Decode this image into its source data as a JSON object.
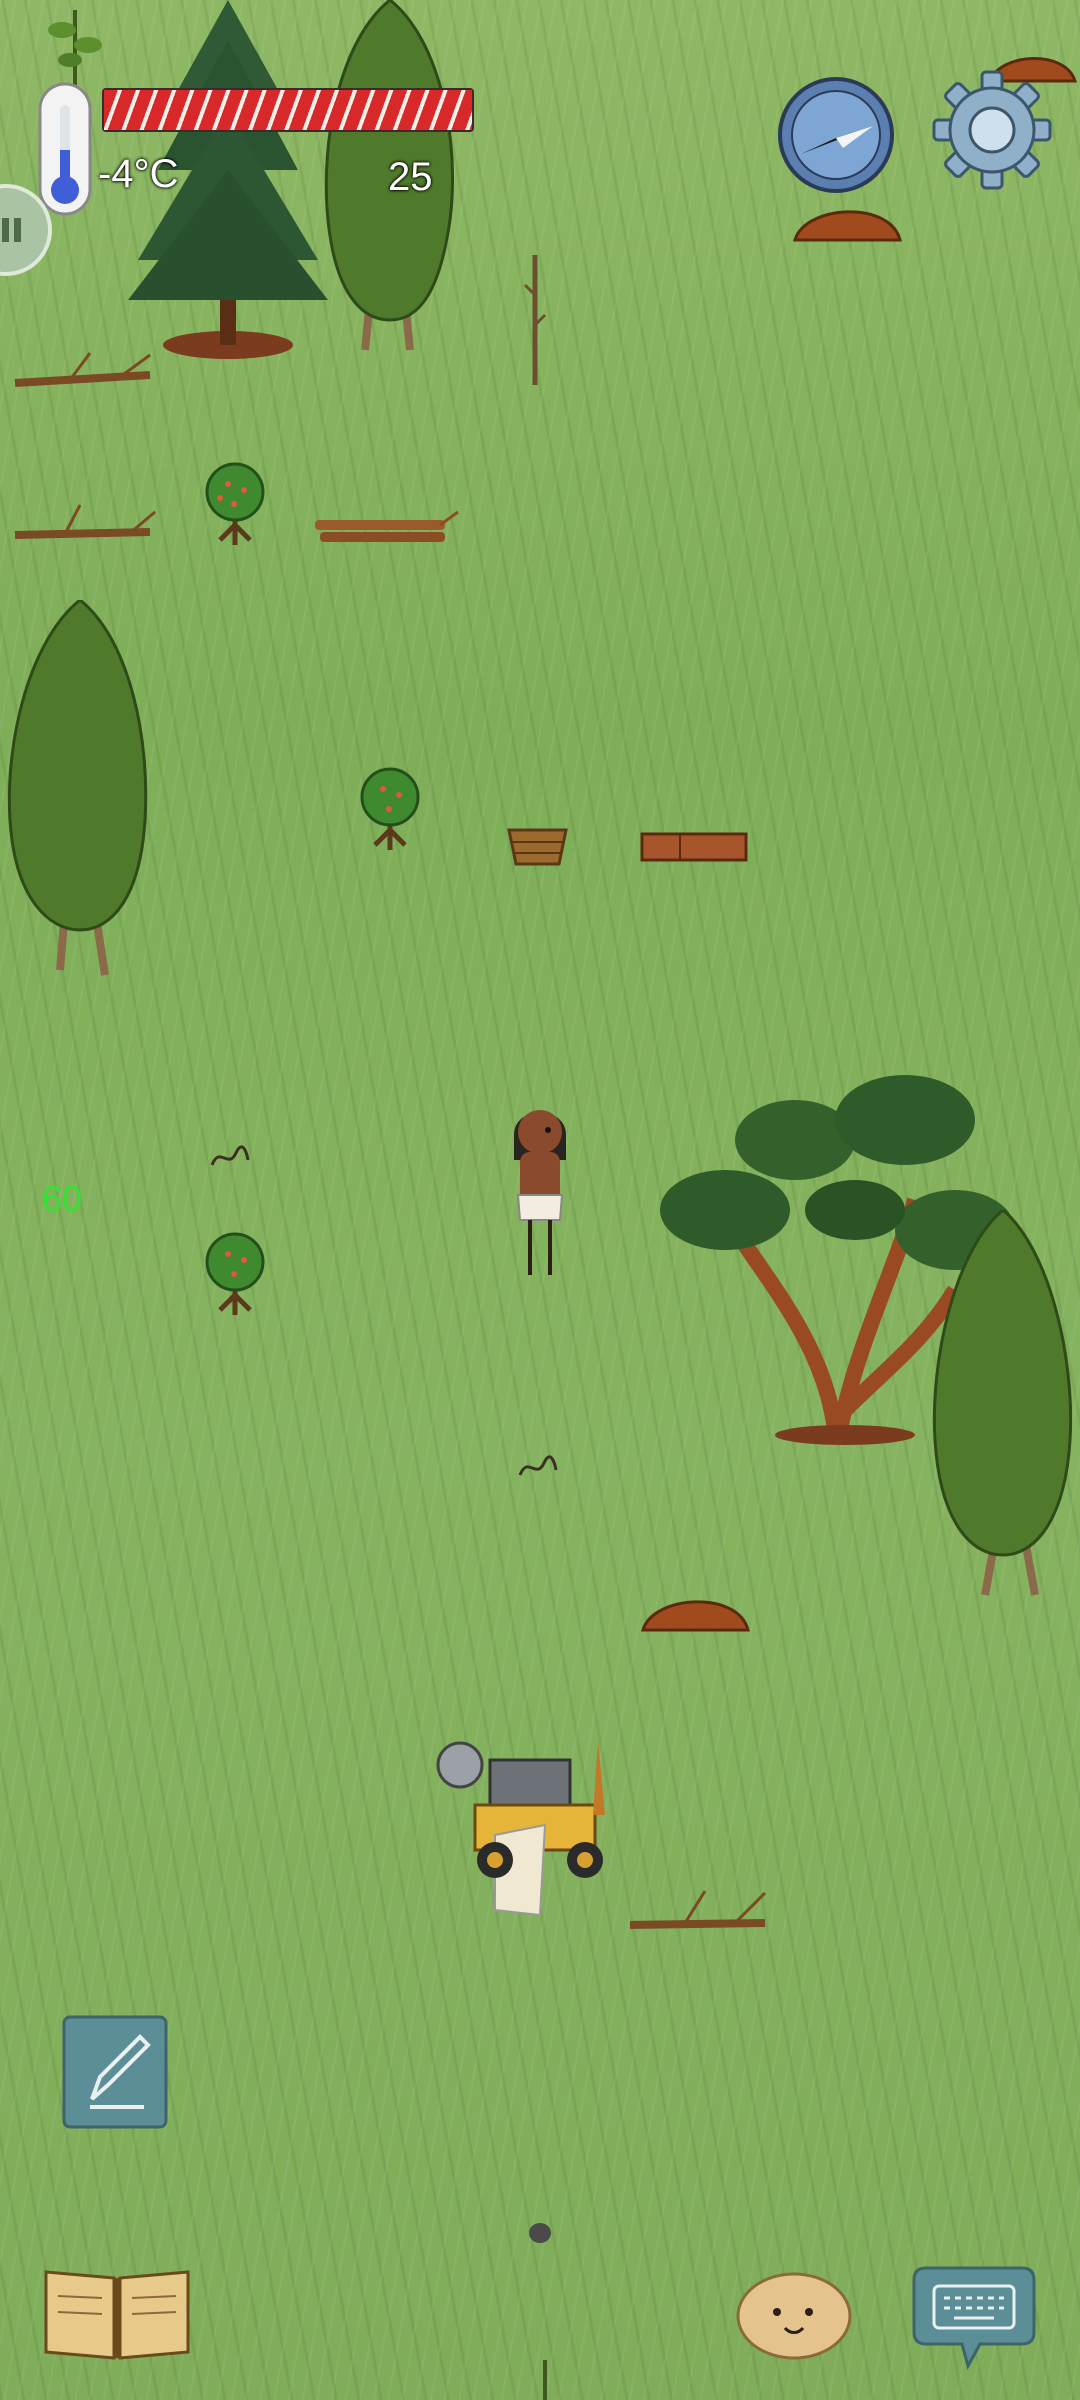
{
  "hud": {
    "temperature": "-4°C",
    "counter": "25",
    "health_fraction": 1.0
  },
  "debug": {
    "fps": "60"
  },
  "icons": {
    "thermometer": "thermometer-icon",
    "compass": "compass-icon",
    "settings": "gear-icon",
    "pause": "pause-icon",
    "note": "pencil-icon",
    "book": "book-icon",
    "emote": "potato-face-icon",
    "keyboard": "keyboard-icon"
  },
  "colors": {
    "health_bar": "#d8282a",
    "grass": "#86b35f",
    "ui_teal": "#5b8e96"
  }
}
